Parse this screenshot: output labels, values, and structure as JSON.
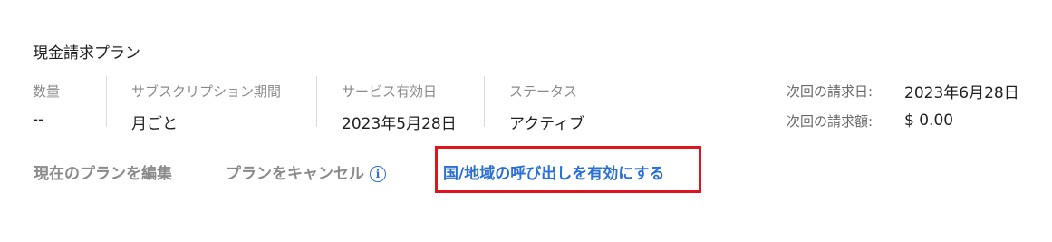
{
  "plan": {
    "title": "現金請求プラン",
    "quantity": {
      "label": "数量",
      "value": "--"
    },
    "subscription_period": {
      "label": "サブスクリプション期間",
      "value": "月ごと"
    },
    "service_start": {
      "label": "サービス有効日",
      "value": "2023年5月28日"
    },
    "status": {
      "label": "ステータス",
      "value": "アクティブ"
    },
    "next_billing_date": {
      "label": "次回の請求日:",
      "value": "2023年6月28日"
    },
    "next_billing_amount": {
      "label": "次回の請求額:",
      "value": "$ 0.00"
    }
  },
  "actions": {
    "edit_plan": "現在のプランを編集",
    "cancel_plan": "プランをキャンセル",
    "info_icon": "i",
    "enable_calling": "国/地域の呼び出しを有効にする"
  },
  "colors": {
    "link": "#2a6fd6",
    "highlight": "#e0141e",
    "muted": "#8a8a8a"
  }
}
